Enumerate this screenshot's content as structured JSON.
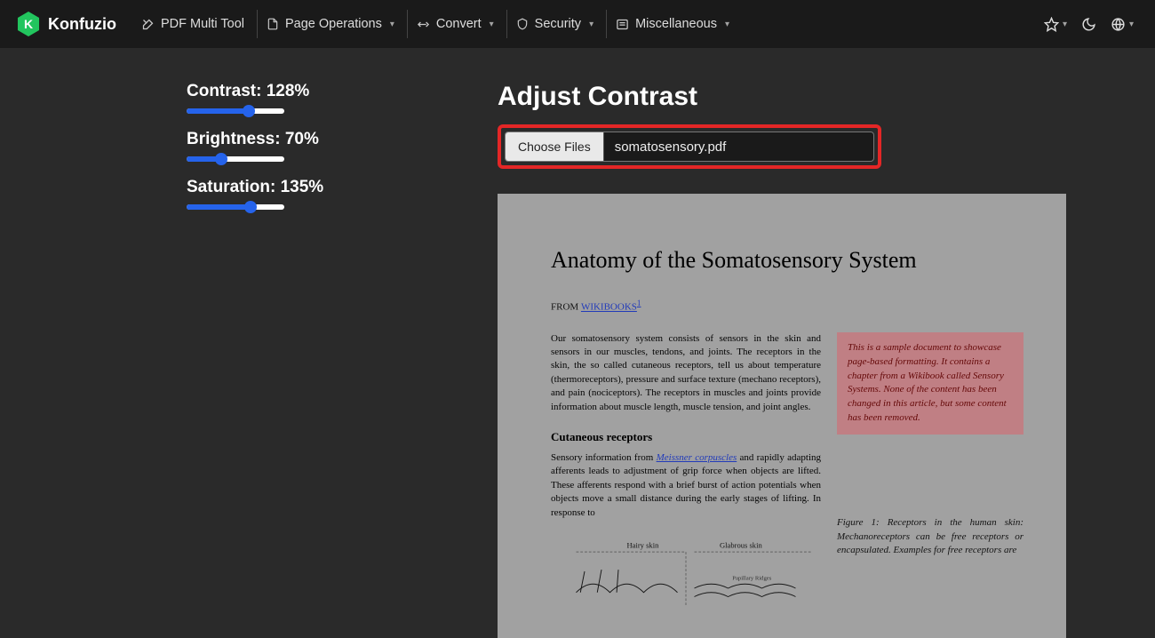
{
  "brand": {
    "letter": "K",
    "name": "Konfuzio"
  },
  "nav": {
    "multi_tool": "PDF Multi Tool",
    "page_ops": "Page Operations",
    "convert": "Convert",
    "security": "Security",
    "misc": "Miscellaneous"
  },
  "sliders": {
    "contrast": {
      "label": "Contrast:",
      "value": "128%",
      "pct": 64
    },
    "brightness": {
      "label": "Brightness:",
      "value": "70%",
      "pct": 35
    },
    "saturation": {
      "label": "Saturation:",
      "value": "135%",
      "pct": 65
    }
  },
  "main": {
    "title": "Adjust Contrast",
    "choose_label": "Choose Files",
    "file_name": "somatosensory.pdf"
  },
  "preview": {
    "title": "Anatomy of the Somatosensory System",
    "from_label": "FROM ",
    "from_link": "WIKIBOOKS",
    "para1": "Our somatosensory system consists of sensors in the skin and sensors in our muscles, tendons, and joints. The receptors in the skin, the so called cutaneous receptors, tell us about temperature (thermoreceptors), pressure and surface texture (mechano receptors), and pain (nociceptors). The receptors in muscles and joints provide information about muscle length, muscle tension, and joint angles.",
    "h2": "Cutaneous receptors",
    "para2a": "Sensory information from ",
    "para2link": "Meissner corpuscles",
    "para2b": " and rapidly adapting afferents leads to adjustment of grip force when objects are lifted. These afferents respond with a brief burst of action potentials when objects move a small distance during the early stages of lifting. In response to",
    "hairy": "Hairy skin",
    "glabrous": "Glabrous skin",
    "ridges": "Papillary Ridges",
    "note": "This is a sample document to showcase page-based formatting. It contains a chapter from a Wikibook called Sensory Systems. None of the content has been changed in this article, but some content has been removed.",
    "figcap": "Figure 1: Receptors in the human skin: Mechanoreceptors can be free receptors or encapsulated. Examples for free receptors are"
  }
}
